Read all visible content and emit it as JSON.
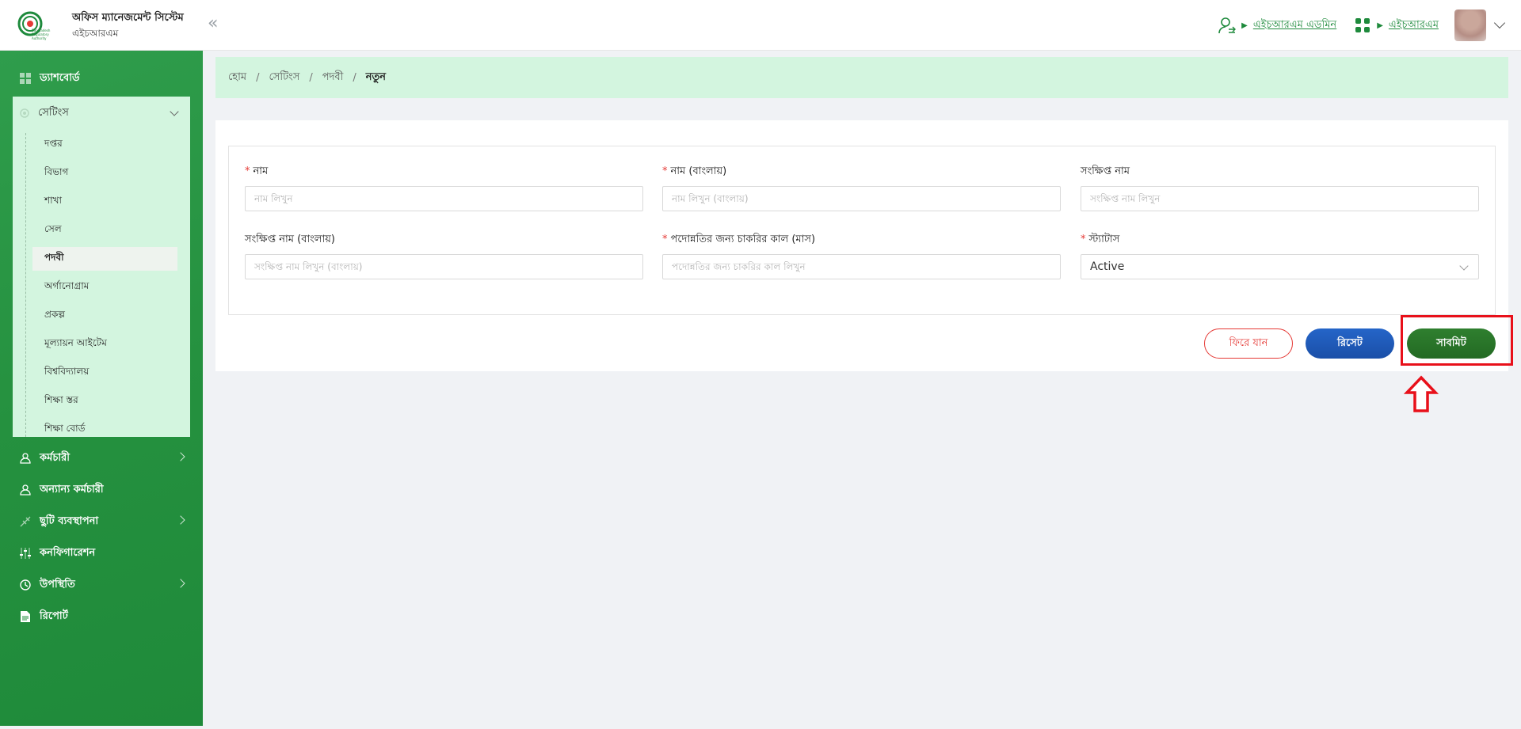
{
  "header": {
    "app_title": "অফিস ম্যানেজমেন্ট সিস্টেম",
    "app_subtitle": "এইচআরএম",
    "user_link": "এইচআরএম এডমিন",
    "module_link": "এইচআরএম",
    "logo_text": "Bangladesh Regulatory Authority"
  },
  "sidebar": {
    "dashboard": "ড্যাশবোর্ড",
    "settings": "সেটিংস",
    "settings_items": [
      "দপ্তর",
      "বিভাগ",
      "শাখা",
      "সেল",
      "পদবী",
      "অর্গানোগ্রাম",
      "প্রকল্প",
      "মূল্যায়ন আইটেম",
      "বিশ্ববিদ্যালয়",
      "শিক্ষা স্তর",
      "শিক্ষা বোর্ড"
    ],
    "active_item": "পদবী",
    "employees": "কর্মচারী",
    "other_employees": "অন্যান্য কর্মচারী",
    "leave": "ছুটি ব্যবস্থাপনা",
    "configuration": "কনফিগারেশন",
    "attendance": "উপস্থিতি",
    "report": "রিপোর্ট"
  },
  "breadcrumb": [
    "হোম",
    "সেটিংস",
    "পদবী",
    "নতুন"
  ],
  "form": {
    "name_label": "নাম",
    "name_placeholder": "নাম লিখুন",
    "name_bn_label": "নাম (বাংলায়)",
    "name_bn_placeholder": "নাম লিখুন (বাংলায়)",
    "short_name_label": "সংক্ষিপ্ত নাম",
    "short_name_placeholder": "সংক্ষিপ্ত নাম লিখুন",
    "short_name_bn_label": "সংক্ষিপ্ত নাম (বাংলায়)",
    "short_name_bn_placeholder": "সংক্ষিপ্ত নাম লিখুন (বাংলায়)",
    "promotion_label": "পদোন্নতির জন্য চাকরির কাল (মাস)",
    "promotion_placeholder": "পদোন্নতির জন্য চাকরির কাল লিখুন",
    "status_label": "স্ট্যাটাস",
    "status_value": "Active",
    "required_mark": "*"
  },
  "buttons": {
    "back": "ফিরে যান",
    "reset": "রিসেট",
    "submit": "সাবমিট"
  },
  "colors": {
    "sidebar": "#25913f",
    "accent_light": "#d3f5df",
    "reset": "#1a4fa8",
    "submit": "#236a23",
    "danger": "#e53935",
    "highlight": "#e8101a"
  }
}
